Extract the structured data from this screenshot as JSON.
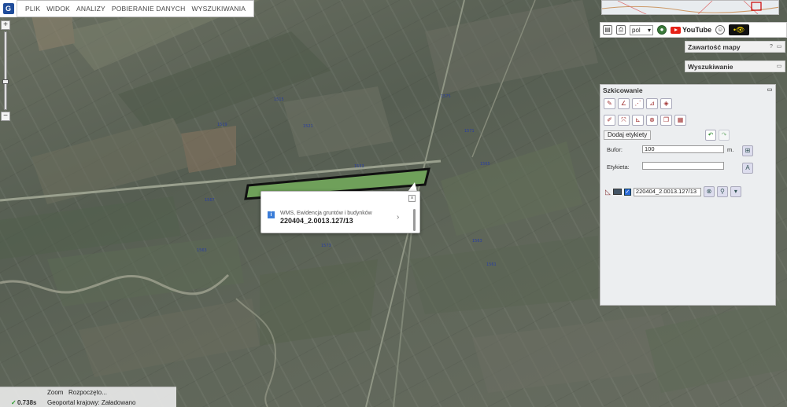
{
  "menu": {
    "items": [
      "PLIK",
      "WIDOK",
      "ANALIZY",
      "POBIERANIE DANYCH",
      "WYSZUKIWANIA"
    ]
  },
  "zoom": {
    "plus": "+",
    "minus": "−"
  },
  "toolbar_top": {
    "language": "pol",
    "youtube": "YouTube",
    "eye_label": "•👁"
  },
  "panels": {
    "map_contents": "Zawartość mapy",
    "search": "Wyszukiwanie",
    "sketch": "Szkicowanie"
  },
  "sketch": {
    "add_label_button": "Dodaj etykiety",
    "buffer_label": "Bufor:",
    "buffer_value": "100",
    "buffer_unit": "m.",
    "label_label": "Etykieta:",
    "label_value": "",
    "item_name": "220404_2.0013.127/13",
    "item_checked": true
  },
  "popup": {
    "source": "WMS, Ewidencja gruntów i budynków",
    "parcel_id": "220404_2.0013.127/13",
    "close": "×",
    "arrow": "›",
    "info": "i"
  },
  "status": {
    "zoom_text": "Zoom",
    "loading_text": "Rozpoczęto...",
    "check": "✓",
    "time": "0.738s",
    "source_text": "Geoportal krajowy: Załadowano"
  },
  "colors": {
    "parcel_fill": "#6fa05a",
    "parcel_stroke": "#111111",
    "youtube_red": "#e62117",
    "panel_bg": "#eceef0"
  },
  "icons": [
    "zoom-in-icon",
    "zoom-out-icon",
    "info-icon",
    "close-icon",
    "chevron-right-icon",
    "eye-icon"
  ]
}
